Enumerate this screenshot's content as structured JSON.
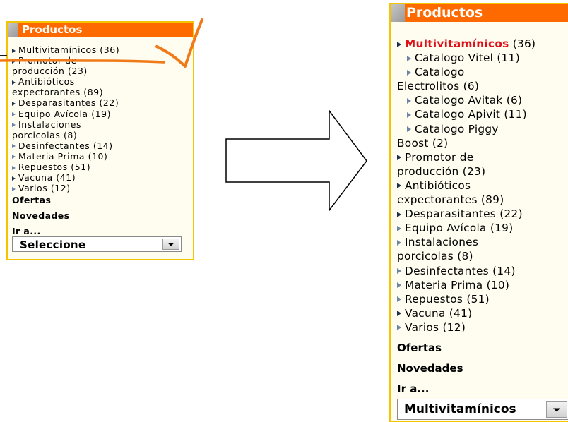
{
  "colors": {
    "header_orange": "#ff6a00",
    "panel_border": "#f5c400",
    "active_red": "#e0101a",
    "annotation_orange": "#f07a18"
  },
  "left_panel": {
    "title": "Productos",
    "items": [
      {
        "label": "Multivitamínicos (36)",
        "bullet": "dark"
      },
      {
        "label": "Promotor de",
        "bullet": "dark"
      },
      {
        "label": "producción (23)",
        "bullet": "none"
      },
      {
        "label": "Antibióticos",
        "bullet": "dark"
      },
      {
        "label": "expectorantes (89)",
        "bullet": "none"
      },
      {
        "label": "Desparasitantes (22)",
        "bullet": "dark"
      },
      {
        "label": "Equipo Avícola (19)",
        "bullet": "light"
      },
      {
        "label": "Instalaciones",
        "bullet": "light"
      },
      {
        "label": "porcicolas (8)",
        "bullet": "none"
      },
      {
        "label": "Desinfectantes (14)",
        "bullet": "light"
      },
      {
        "label": "Materia Prima (10)",
        "bullet": "light"
      },
      {
        "label": "Repuestos (51)",
        "bullet": "light"
      },
      {
        "label": "Vacuna (41)",
        "bullet": "dark"
      },
      {
        "label": "Varios (12)",
        "bullet": "light"
      }
    ],
    "ofertas": "Ofertas",
    "novedades": "Novedades",
    "ira": "Ir a...",
    "select_value": "Seleccione"
  },
  "right_panel": {
    "title": "Productos",
    "items": [
      {
        "label": "Multivitamínicos",
        "count": " (36)",
        "bullet": "dark",
        "active": true,
        "indent": false
      },
      {
        "label": "Catalogo Vitel (11)",
        "bullet": "light",
        "indent": true
      },
      {
        "label": "Catalogo",
        "bullet": "light",
        "indent": true
      },
      {
        "label": "Electrolitos (6)",
        "bullet": "none",
        "indent": false
      },
      {
        "label": "Catalogo Avitak (6)",
        "bullet": "light",
        "indent": true
      },
      {
        "label": "Catalogo Apivit (11)",
        "bullet": "light",
        "indent": true
      },
      {
        "label": "Catalogo Piggy",
        "bullet": "light",
        "indent": true
      },
      {
        "label": "Boost (2)",
        "bullet": "none",
        "indent": false
      },
      {
        "label": "Promotor de",
        "bullet": "dark",
        "indent": false
      },
      {
        "label": "producción (23)",
        "bullet": "none",
        "indent": false
      },
      {
        "label": "Antibióticos",
        "bullet": "dark",
        "indent": false
      },
      {
        "label": "expectorantes (89)",
        "bullet": "none",
        "indent": false
      },
      {
        "label": "Desparasitantes (22)",
        "bullet": "dark",
        "indent": false
      },
      {
        "label": "Equipo Avícola (19)",
        "bullet": "light",
        "indent": false
      },
      {
        "label": "Instalaciones",
        "bullet": "light",
        "indent": false
      },
      {
        "label": "porcicolas (8)",
        "bullet": "none",
        "indent": false
      },
      {
        "label": "Desinfectantes (14)",
        "bullet": "light",
        "indent": false
      },
      {
        "label": "Materia Prima (10)",
        "bullet": "light",
        "indent": false
      },
      {
        "label": "Repuestos (51)",
        "bullet": "light",
        "indent": false
      },
      {
        "label": "Vacuna (41)",
        "bullet": "dark",
        "indent": false
      },
      {
        "label": "Varios (12)",
        "bullet": "light",
        "indent": false
      }
    ],
    "ofertas": "Ofertas",
    "novedades": "Novedades",
    "ira": "Ir a...",
    "select_value": "Multivitamínicos"
  }
}
